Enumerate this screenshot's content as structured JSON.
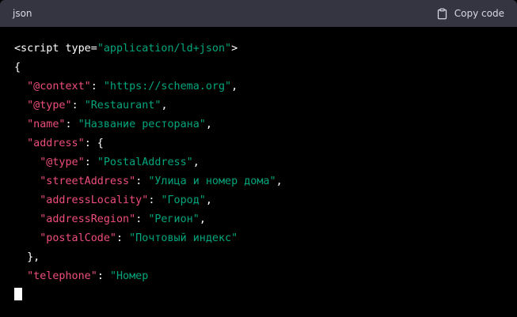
{
  "header": {
    "language": "json",
    "copy_label": "Copy code",
    "copy_icon": "clipboard-icon"
  },
  "colors": {
    "header_bg": "#343541",
    "code_bg": "#000000",
    "key": "#ef4e7b",
    "string": "#00a67d",
    "plain": "#ffffff"
  },
  "code_lines": [
    [
      {
        "t": "plain",
        "v": "<script type="
      },
      {
        "t": "str",
        "v": "\"application/ld+json\""
      },
      {
        "t": "plain",
        "v": ">"
      }
    ],
    [
      {
        "t": "plain",
        "v": "{"
      }
    ],
    [
      {
        "t": "plain",
        "v": "  "
      },
      {
        "t": "key",
        "v": "\"@context\""
      },
      {
        "t": "plain",
        "v": ": "
      },
      {
        "t": "str",
        "v": "\"https://schema.org\""
      },
      {
        "t": "plain",
        "v": ","
      }
    ],
    [
      {
        "t": "plain",
        "v": "  "
      },
      {
        "t": "key",
        "v": "\"@type\""
      },
      {
        "t": "plain",
        "v": ": "
      },
      {
        "t": "str",
        "v": "\"Restaurant\""
      },
      {
        "t": "plain",
        "v": ","
      }
    ],
    [
      {
        "t": "plain",
        "v": "  "
      },
      {
        "t": "key",
        "v": "\"name\""
      },
      {
        "t": "plain",
        "v": ": "
      },
      {
        "t": "str",
        "v": "\"Название ресторана\""
      },
      {
        "t": "plain",
        "v": ","
      }
    ],
    [
      {
        "t": "plain",
        "v": "  "
      },
      {
        "t": "key",
        "v": "\"address\""
      },
      {
        "t": "plain",
        "v": ": {"
      }
    ],
    [
      {
        "t": "plain",
        "v": "    "
      },
      {
        "t": "key",
        "v": "\"@type\""
      },
      {
        "t": "plain",
        "v": ": "
      },
      {
        "t": "str",
        "v": "\"PostalAddress\""
      },
      {
        "t": "plain",
        "v": ","
      }
    ],
    [
      {
        "t": "plain",
        "v": "    "
      },
      {
        "t": "key",
        "v": "\"streetAddress\""
      },
      {
        "t": "plain",
        "v": ": "
      },
      {
        "t": "str",
        "v": "\"Улица и номер дома\""
      },
      {
        "t": "plain",
        "v": ","
      }
    ],
    [
      {
        "t": "plain",
        "v": "    "
      },
      {
        "t": "key",
        "v": "\"addressLocality\""
      },
      {
        "t": "plain",
        "v": ": "
      },
      {
        "t": "str",
        "v": "\"Город\""
      },
      {
        "t": "plain",
        "v": ","
      }
    ],
    [
      {
        "t": "plain",
        "v": "    "
      },
      {
        "t": "key",
        "v": "\"addressRegion\""
      },
      {
        "t": "plain",
        "v": ": "
      },
      {
        "t": "str",
        "v": "\"Регион\""
      },
      {
        "t": "plain",
        "v": ","
      }
    ],
    [
      {
        "t": "plain",
        "v": "    "
      },
      {
        "t": "key",
        "v": "\"postalCode\""
      },
      {
        "t": "plain",
        "v": ": "
      },
      {
        "t": "str",
        "v": "\"Почтовый индекс\""
      }
    ],
    [
      {
        "t": "plain",
        "v": "  },"
      }
    ],
    [
      {
        "t": "plain",
        "v": "  "
      },
      {
        "t": "key",
        "v": "\"telephone\""
      },
      {
        "t": "plain",
        "v": ": "
      },
      {
        "t": "str",
        "v": "\"Номер"
      }
    ]
  ]
}
